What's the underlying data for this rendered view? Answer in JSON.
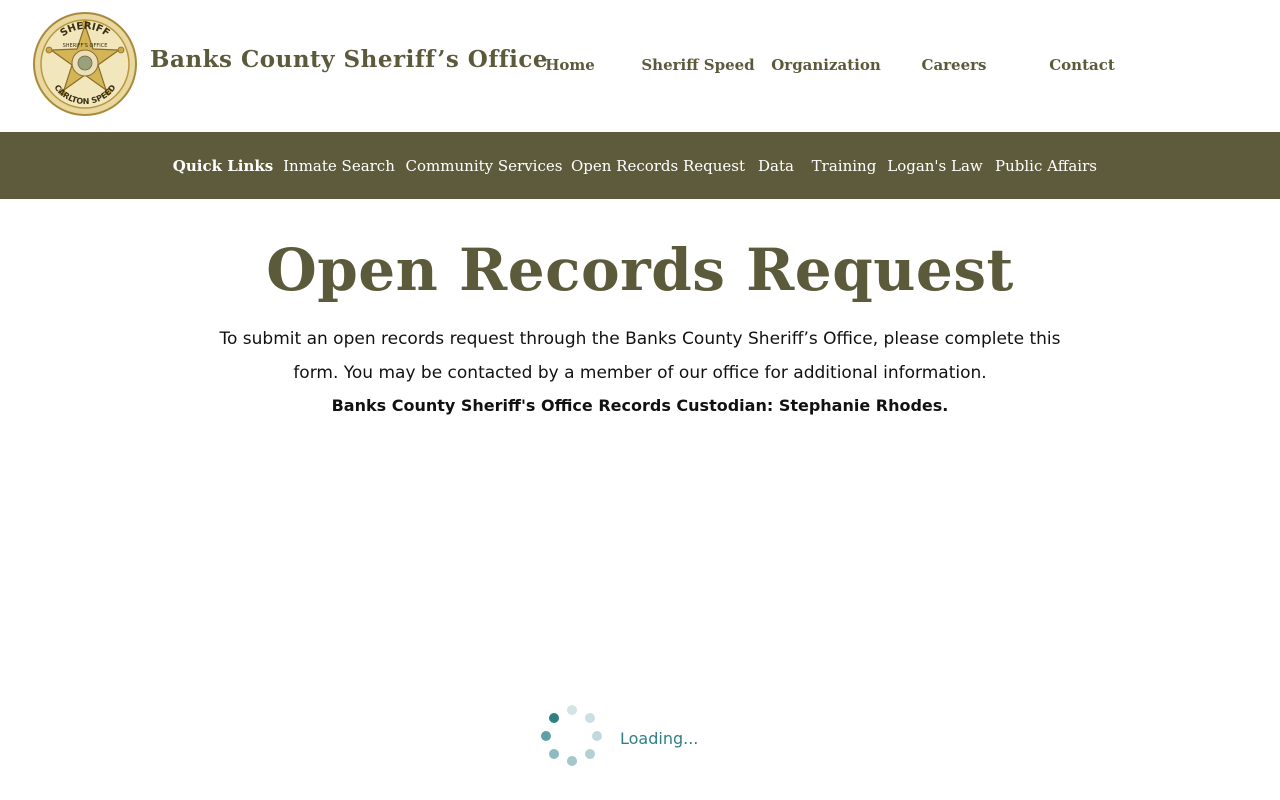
{
  "header": {
    "site_title": "Banks County Sheriff’s Office",
    "badge": {
      "top_text": "SHERIFF",
      "inner_text": "SHERIFF'S OFFICE",
      "bottom_text": "CARLTON SPEED"
    },
    "nav": [
      {
        "label": "Home"
      },
      {
        "label": "Sheriff Speed"
      },
      {
        "label": "Organization"
      },
      {
        "label": "Careers"
      },
      {
        "label": "Contact"
      }
    ]
  },
  "quick_links": [
    {
      "label": "Quick Links"
    },
    {
      "label": "Inmate Search"
    },
    {
      "label": "Community Services"
    },
    {
      "label": "Open Records Request"
    },
    {
      "label": "Data"
    },
    {
      "label": "Training"
    },
    {
      "label": "Logan's Law"
    },
    {
      "label": "Public Affairs"
    }
  ],
  "main": {
    "title": "Open Records Request",
    "intro": "To submit an open records request through the Banks County Sheriff’s Office, please complete this form. You may be contacted by a member of our office for additional information.",
    "custodian": "Banks County Sheriff's Office Records Custodian: Stephanie Rhodes."
  },
  "loader": {
    "text": "Loading..."
  },
  "colors": {
    "brand": "#5b5a3a",
    "bar": "#5d5b3b",
    "loader": "#2f7f85",
    "badge_gold": "#c9a84a"
  }
}
